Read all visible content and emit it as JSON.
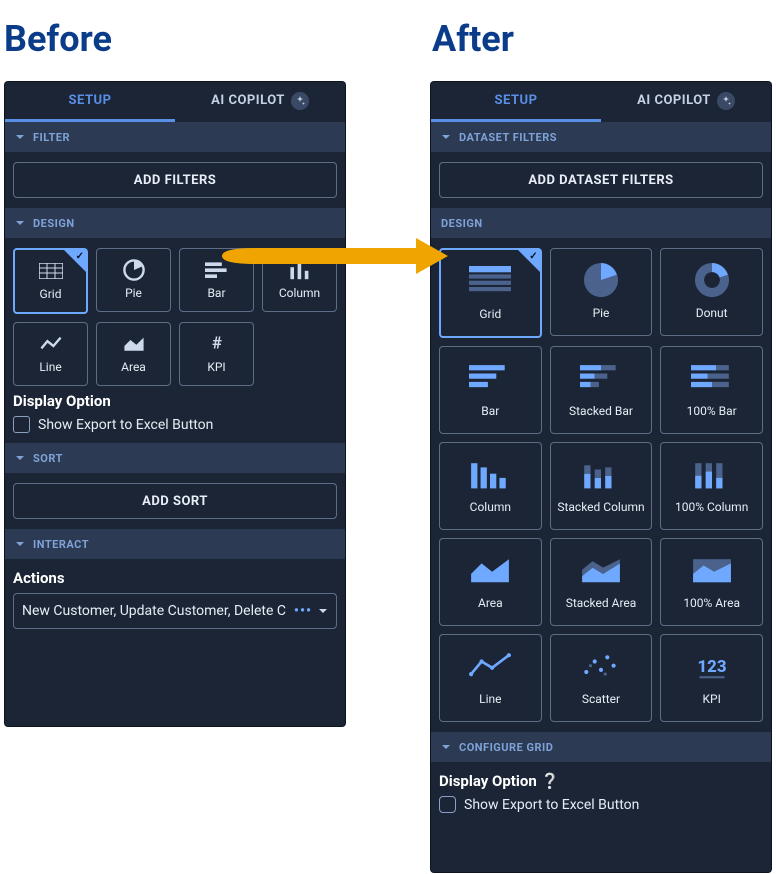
{
  "headings": {
    "before": "Before",
    "after": "After"
  },
  "tabs": {
    "setup": "SETUP",
    "ai": "AI COPILOT"
  },
  "before": {
    "filter": {
      "title": "FILTER",
      "button": "ADD FILTERS"
    },
    "design": {
      "title": "DESIGN",
      "tiles": [
        "Grid",
        "Pie",
        "Bar",
        "Column",
        "Line",
        "Area",
        "KPI"
      ],
      "selected": "Grid",
      "display_option_title": "Display Option",
      "export_label": "Show Export to Excel Button"
    },
    "sort": {
      "title": "SORT",
      "button": "ADD SORT"
    },
    "interact": {
      "title": "INTERACT",
      "actions_label": "Actions",
      "actions_value": "New Customer, Update Customer, Delete C"
    }
  },
  "after": {
    "filter": {
      "title": "DATASET FILTERS",
      "button": "ADD DATASET FILTERS"
    },
    "design": {
      "title": "DESIGN",
      "tiles": [
        "Grid",
        "Pie",
        "Donut",
        "Bar",
        "Stacked Bar",
        "100% Bar",
        "Column",
        "Stacked Column",
        "100% Column",
        "Area",
        "Stacked Area",
        "100% Area",
        "Line",
        "Scatter",
        "KPI"
      ],
      "selected": "Grid"
    },
    "configure": {
      "title": "CONFIGURE GRID",
      "display_option_title": "Display Option",
      "export_label": "Show Export to Excel Button"
    }
  }
}
